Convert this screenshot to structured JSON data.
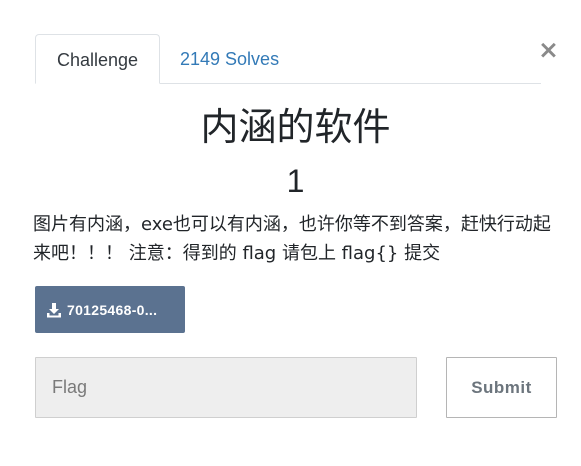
{
  "modal": {
    "close_symbol": "×"
  },
  "tabs": [
    {
      "label": "Challenge",
      "active": true
    },
    {
      "label": "2149 Solves",
      "active": false
    }
  ],
  "challenge": {
    "name": "内涵的软件",
    "value": "1",
    "description": "图片有内涵，exe也可以有内涵，也许你等不到答案，赶快行动起来吧！！！ 注意：得到的 flag 请包上 flag{} 提交",
    "file_label": "70125468-0...",
    "file_icon": "download-icon"
  },
  "flag_input": {
    "placeholder": "Flag",
    "value": ""
  },
  "submit": {
    "label": "Submit"
  },
  "colors": {
    "download_button_bg": "#5b7290",
    "tab_link": "#337ab7",
    "input_bg": "#eeeeee"
  }
}
